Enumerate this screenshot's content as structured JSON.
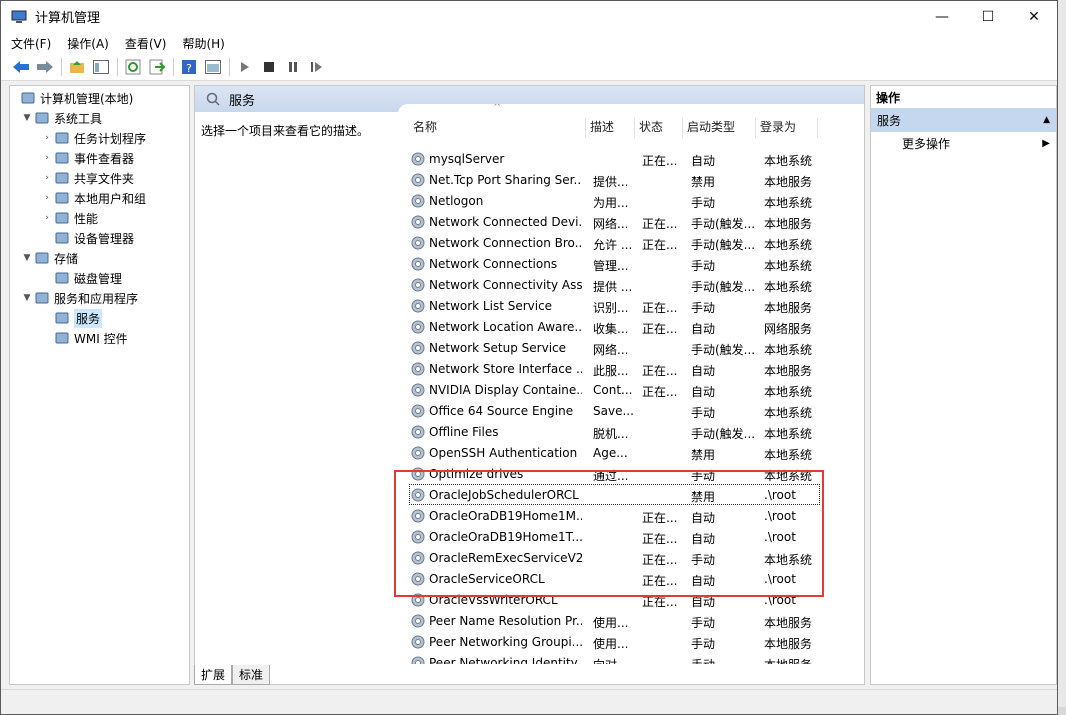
{
  "window": {
    "title": "计算机管理"
  },
  "menu": [
    "文件(F)",
    "操作(A)",
    "查看(V)",
    "帮助(H)"
  ],
  "toolbar": [
    "back-icon",
    "forward-icon",
    "sep",
    "up-folder-icon",
    "show-tree-icon",
    "sep",
    "refresh-icon",
    "export-icon",
    "sep",
    "help-icon",
    "properties-icon",
    "sep",
    "play-icon",
    "stop-icon",
    "pause-icon",
    "resume-icon"
  ],
  "tree": [
    {
      "label": "计算机管理(本地)",
      "level": 0,
      "arrow": "",
      "icon": "computer-icon"
    },
    {
      "label": "系统工具",
      "level": 1,
      "arrow": "▼",
      "icon": "tools-icon"
    },
    {
      "label": "任务计划程序",
      "level": 2,
      "arrow": "›",
      "icon": "clock-icon"
    },
    {
      "label": "事件查看器",
      "level": 2,
      "arrow": "›",
      "icon": "event-icon"
    },
    {
      "label": "共享文件夹",
      "level": 2,
      "arrow": "›",
      "icon": "shared-folder-icon"
    },
    {
      "label": "本地用户和组",
      "level": 2,
      "arrow": "›",
      "icon": "users-icon"
    },
    {
      "label": "性能",
      "level": 2,
      "arrow": "›",
      "icon": "performance-icon"
    },
    {
      "label": "设备管理器",
      "level": 2,
      "arrow": "",
      "icon": "device-icon"
    },
    {
      "label": "存储",
      "level": 1,
      "arrow": "▼",
      "icon": "storage-icon"
    },
    {
      "label": "磁盘管理",
      "level": 2,
      "arrow": "",
      "icon": "disk-icon"
    },
    {
      "label": "服务和应用程序",
      "level": 1,
      "arrow": "▼",
      "icon": "apps-icon"
    },
    {
      "label": "服务",
      "level": 2,
      "arrow": "",
      "icon": "services-icon",
      "selected": true
    },
    {
      "label": "WMI 控件",
      "level": 2,
      "arrow": "",
      "icon": "wmi-icon"
    }
  ],
  "middle": {
    "header": "服务",
    "description": "选择一个项目来查看它的描述。"
  },
  "columns": [
    "名称",
    "描述",
    "状态",
    "启动类型",
    "登录为"
  ],
  "services": [
    [
      "mysqlServer",
      "",
      "正在...",
      "自动",
      "本地系统"
    ],
    [
      "Net.Tcp Port Sharing Ser...",
      "提供...",
      "",
      "禁用",
      "本地服务"
    ],
    [
      "Netlogon",
      "为用...",
      "",
      "手动",
      "本地系统"
    ],
    [
      "Network Connected Devi...",
      "网络...",
      "正在...",
      "手动(触发...",
      "本地服务"
    ],
    [
      "Network Connection Bro...",
      "允许 ...",
      "正在...",
      "手动(触发...",
      "本地系统"
    ],
    [
      "Network Connections",
      "管理...",
      "",
      "手动",
      "本地系统"
    ],
    [
      "Network Connectivity Ass...",
      "提供 ...",
      "",
      "手动(触发...",
      "本地系统"
    ],
    [
      "Network List Service",
      "识别...",
      "正在...",
      "手动",
      "本地服务"
    ],
    [
      "Network Location Aware...",
      "收集...",
      "正在...",
      "自动",
      "网络服务"
    ],
    [
      "Network Setup Service",
      "网络...",
      "",
      "手动(触发...",
      "本地系统"
    ],
    [
      "Network Store Interface ...",
      "此服...",
      "正在...",
      "自动",
      "本地服务"
    ],
    [
      "NVIDIA Display Containe...",
      "Cont...",
      "正在...",
      "自动",
      "本地系统"
    ],
    [
      "Office 64 Source Engine",
      "Save...",
      "",
      "手动",
      "本地系统"
    ],
    [
      "Offline Files",
      "脱机...",
      "",
      "手动(触发...",
      "本地系统"
    ],
    [
      "OpenSSH Authentication ...",
      "Age...",
      "",
      "禁用",
      "本地系统"
    ],
    [
      "Optimize drives",
      "通过...",
      "",
      "手动",
      "本地系统"
    ],
    [
      "OracleJobSchedulerORCL",
      "",
      "",
      "禁用",
      ".\\root"
    ],
    [
      "OracleOraDB19Home1M...",
      "",
      "正在...",
      "自动",
      ".\\root"
    ],
    [
      "OracleOraDB19Home1T...",
      "",
      "正在...",
      "自动",
      ".\\root"
    ],
    [
      "OracleRemExecServiceV2",
      "",
      "正在...",
      "手动",
      "本地系统"
    ],
    [
      "OracleServiceORCL",
      "",
      "正在...",
      "自动",
      ".\\root"
    ],
    [
      "OracleVssWriterORCL",
      "",
      "正在...",
      "自动",
      ".\\root"
    ],
    [
      "Peer Name Resolution Pr...",
      "使用...",
      "",
      "手动",
      "本地服务"
    ],
    [
      "Peer Networking Groupi...",
      "使用...",
      "",
      "手动",
      "本地服务"
    ],
    [
      "Peer Networking Identity...",
      "向对...",
      "",
      "手动",
      "本地服务"
    ]
  ],
  "focused_row": 16,
  "highlight_color": "#e03c31",
  "tabs": [
    "扩展",
    "标准"
  ],
  "actions": {
    "header": "操作",
    "section": "服务",
    "more": "更多操作"
  }
}
